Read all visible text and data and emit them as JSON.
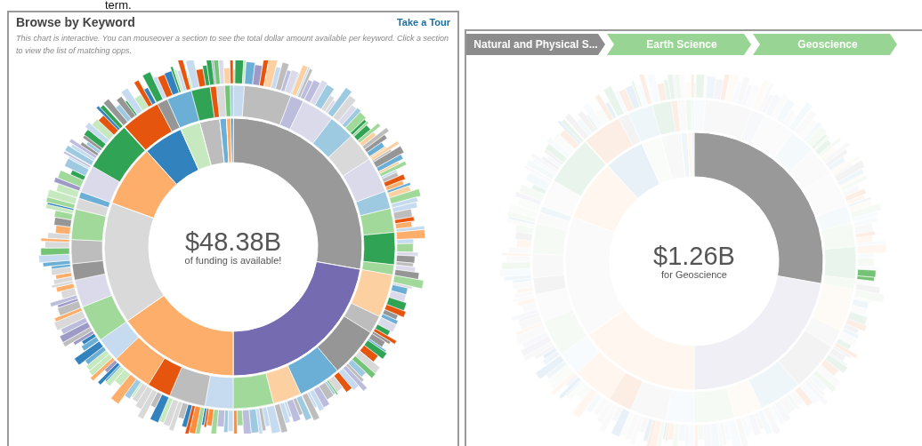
{
  "caption": "term.",
  "browse_panel": {
    "title": "Browse by Keyword",
    "tour_link": "Take a Tour",
    "description": "This chart is interactive. You can mouseover a section to see the total dollar amount available per keyword. Click a section to view the list of matching opps.",
    "total": "$48.38B",
    "total_caption": "of funding is available!"
  },
  "detail_panel": {
    "breadcrumbs": [
      {
        "label": "Natural and Physical S...",
        "color": "#8c8c8c"
      },
      {
        "label": "Earth Science",
        "color": "#98d594"
      },
      {
        "label": "Geoscience",
        "color": "#98d594"
      }
    ],
    "total": "$1.26B",
    "total_caption": "for Geoscience"
  }
}
